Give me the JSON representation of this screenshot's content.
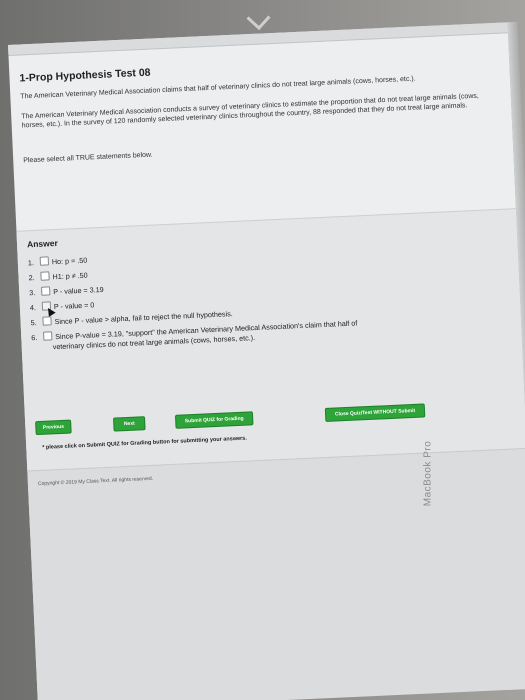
{
  "question": {
    "title": "1-Prop Hypothesis Test 08",
    "claim": "The American Veterinary Medical Association claims that half of veterinary clinics do not treat large animals (cows, horses, etc.).",
    "scenario": "The American Veterinary Medical Association conducts a survey of veterinary clinics to estimate the proportion that do not treat large animals (cows, horses, etc.). In the survey of 120 randomly selected veterinary clinics throughout the country, 88 responded that they do not treat large animals.",
    "prompt": "Please select all TRUE statements below."
  },
  "answer": {
    "heading": "Answer",
    "options": [
      {
        "number": "1.",
        "text": "Ho: p = .50"
      },
      {
        "number": "2.",
        "text": "H1: p ≠ .50"
      },
      {
        "number": "3.",
        "text": "P - value = 3.19"
      },
      {
        "number": "4.",
        "text": "P - value = 0"
      },
      {
        "number": "5.",
        "text": "Since P - value > alpha, fail to reject the null hypothesis."
      },
      {
        "number": "6.",
        "text": "Since P-value = 3.19, \"support\" the American Veterinary Medical Association's claim that half of",
        "text2": "veterinary clinics do not treat large animals (cows, horses, etc.)."
      }
    ]
  },
  "buttons": {
    "previous": "Previous",
    "next": "Next",
    "submit": "Submit QUIZ for Grading",
    "close": "Close Quiz/Test WITHOUT Submit"
  },
  "note": "* please click on Submit QUIZ for Grading button for submitting your answers.",
  "footer": {
    "copyright": "Copyright © 2019 My Class Text, All rights reserved."
  },
  "device": {
    "brand": "MacBook Pro"
  },
  "colors": {
    "button_green": "#2ea33a",
    "page_bg": "#eceeef",
    "answer_bg": "#e3e5e7"
  }
}
